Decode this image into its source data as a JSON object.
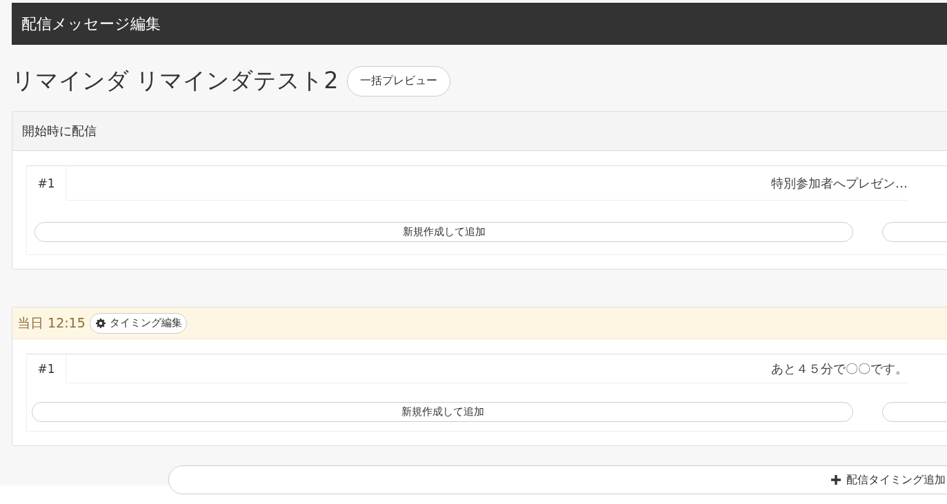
{
  "header": {
    "title": "配信メッセージ編集"
  },
  "page_title": "リマインダ リマインダテスト2",
  "preview_button": "一括プレビュー",
  "sections": [
    {
      "kind": "start",
      "label": "開始時に配信",
      "messages": [
        {
          "number": "#1",
          "text": "特別参加者へプレゼン…"
        }
      ],
      "add_button": "新規作成して追加"
    },
    {
      "kind": "timing",
      "label": "当日 12:15",
      "edit_button": "タイミング編集",
      "messages": [
        {
          "number": "#1",
          "text": "あと４５分で〇〇です。"
        }
      ],
      "add_button": "新規作成して追加"
    }
  ],
  "add_timing_button": "配信タイミング追加"
}
